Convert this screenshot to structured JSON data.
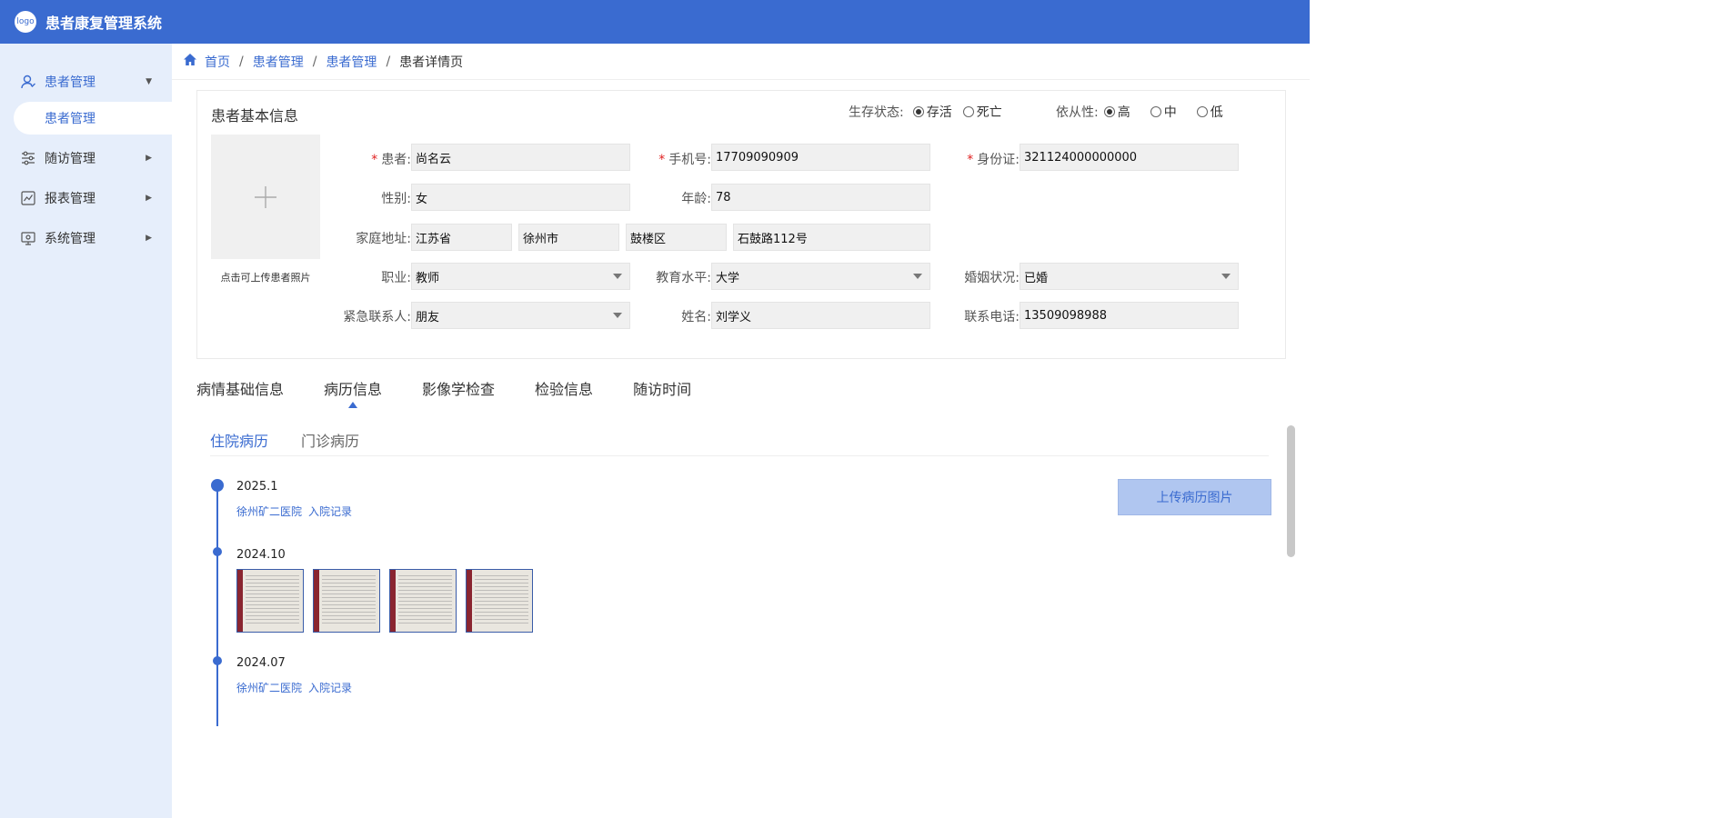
{
  "app": {
    "logo_text": "logo",
    "title": "患者康复管理系统",
    "accent": "#3a6bd0"
  },
  "sidebar": {
    "groups": [
      {
        "label": "患者管理",
        "icon": "user-icon",
        "expanded": true,
        "active": true
      },
      {
        "label": "随访管理",
        "icon": "sliders-icon"
      },
      {
        "label": "报表管理",
        "icon": "chart-icon"
      },
      {
        "label": "系统管理",
        "icon": "monitor-icon"
      }
    ],
    "sub_item": "患者管理"
  },
  "breadcrumb": {
    "items": [
      "首页",
      "患者管理",
      "患者管理"
    ],
    "separator": "/",
    "current": "患者详情页"
  },
  "basic_info": {
    "title": "患者基本信息",
    "survival": {
      "label": "生存状态:",
      "options": [
        "存活",
        "死亡"
      ],
      "selected": "存活"
    },
    "compliance": {
      "label": "依从性:",
      "options": [
        "高",
        "中",
        "低"
      ],
      "selected": "高"
    },
    "photo_hint": "点击可上传患者照片",
    "fields": {
      "patient": {
        "label": "患者:",
        "value": "尚名云",
        "required": true
      },
      "phone": {
        "label": "手机号:",
        "value": "17709090909",
        "required": true
      },
      "id_card": {
        "label": "身份证:",
        "value": "321124000000000",
        "required": true
      },
      "gender": {
        "label": "性别:",
        "value": "女"
      },
      "age": {
        "label": "年龄:",
        "value": "78"
      },
      "address": {
        "label": "家庭地址:",
        "province": "江苏省",
        "city": "徐州市",
        "district": "鼓楼区",
        "street": "石鼓路112号"
      },
      "occupation": {
        "label": "职业:",
        "value": "教师"
      },
      "education": {
        "label": "教育水平:",
        "value": "大学"
      },
      "marital": {
        "label": "婚姻状况:",
        "value": "已婚"
      },
      "emergency": {
        "label": "紧急联系人:",
        "value": "朋友"
      },
      "contact_name": {
        "label": "姓名:",
        "value": "刘学义"
      },
      "contact_phone": {
        "label": "联系电话:",
        "value": "13509098988"
      }
    },
    "required_mark": "*"
  },
  "tabs": {
    "items": [
      "病情基础信息",
      "病历信息",
      "影像学检查",
      "检验信息",
      "随访时间"
    ],
    "active": "病历信息"
  },
  "subtabs": {
    "items": [
      "住院病历",
      "门诊病历"
    ],
    "active": "住院病历"
  },
  "upload_button": "上传病历图片",
  "timeline": [
    {
      "date": "2025.1",
      "hospital": "徐州矿二医院",
      "record": "入院记录"
    },
    {
      "date": "2024.10",
      "image_count": 4
    },
    {
      "date": "2024.07",
      "hospital": "徐州矿二医院",
      "record": "入院记录"
    }
  ]
}
